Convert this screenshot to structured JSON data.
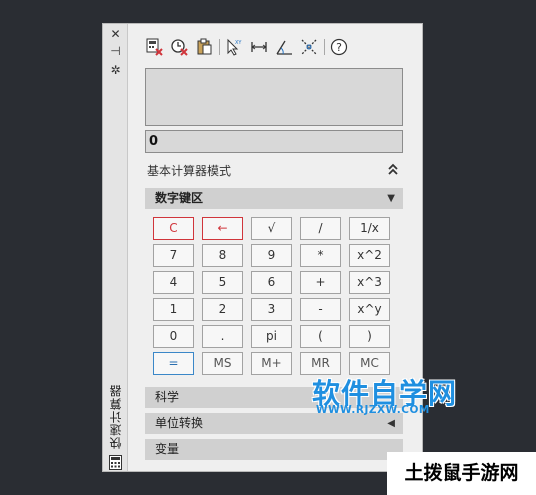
{
  "window": {
    "side_title": "快速计算器",
    "controls": {
      "close": "✕",
      "pin": "⊣",
      "settings": "✲"
    }
  },
  "toolbar": {
    "icons": [
      "clear-calc-icon",
      "clear-history-icon",
      "paste-to-commandline-icon",
      "get-coordinates-icon",
      "distance-between-points-icon",
      "angle-of-line-icon",
      "intersection-of-lines-icon",
      "help-icon"
    ],
    "help_label": "?"
  },
  "display": {
    "history": "",
    "entry": "0"
  },
  "mode": {
    "label": "基本计算器模式"
  },
  "numpad": {
    "title": "数字键区",
    "keys": [
      [
        "C",
        "←",
        "√",
        "/",
        "1/x"
      ],
      [
        "7",
        "8",
        "9",
        "*",
        "x^2"
      ],
      [
        "4",
        "5",
        "6",
        "+",
        "x^3"
      ],
      [
        "1",
        "2",
        "3",
        "-",
        "x^y"
      ],
      [
        "0",
        ".",
        "pi",
        "(",
        ")"
      ],
      [
        "=",
        "MS",
        "M+",
        "MR",
        "MC"
      ]
    ]
  },
  "sections": {
    "science": "科学",
    "units": "单位转换",
    "variables": "变量"
  },
  "watermark": {
    "site": "软件自学网",
    "url": "WWW.RJZXW.COM",
    "footer": "土拨鼠手游网"
  },
  "colors": {
    "panel_bg": "#efefef",
    "desktop_bg": "#2a2d33",
    "clear_red": "#d0353b",
    "equals_blue": "#3a87c8",
    "watermark_blue": "#1f8fe0"
  }
}
